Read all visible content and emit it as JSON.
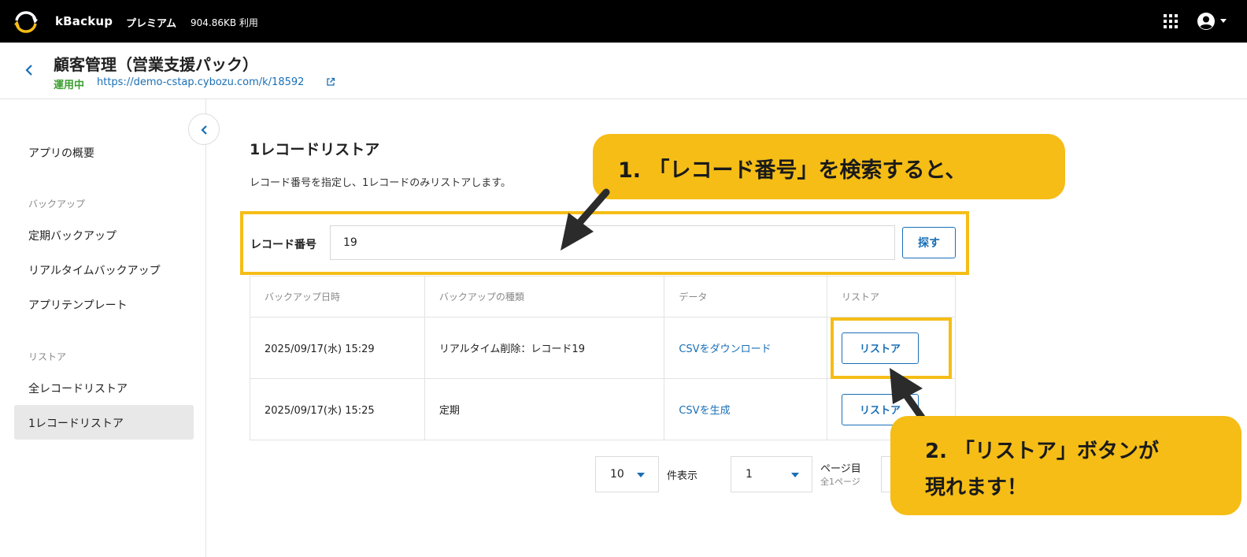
{
  "topbar": {
    "brand": "kBackup",
    "plan": "プレミアム",
    "usage": "904.86KB 利用",
    "icons": [
      "kbackup-logo-icon",
      "apps-grid-icon",
      "user-account-icon",
      "caret-down-icon"
    ]
  },
  "app": {
    "title": "顧客管理（営業支援パック）",
    "status": "運用中",
    "url": "https://demo-cstap.cybozu.com/k/18592"
  },
  "sidebar": {
    "overview": "アプリの概要",
    "backup_section": "バックアップ",
    "backup_items": [
      "定期バックアップ",
      "リアルタイムバックアップ",
      "アプリテンプレート"
    ],
    "restore_section": "リストア",
    "restore_items": [
      "全レコードリストア",
      "1レコードリストア"
    ],
    "active_item": "1レコードリストア"
  },
  "main": {
    "title": "1レコードリストア",
    "description": "レコード番号を指定し、1レコードのみリストアします。",
    "search": {
      "label": "レコード番号",
      "value": "19",
      "button": "探す"
    },
    "table": {
      "headers": [
        "バックアップ日時",
        "バックアップの種類",
        "データ",
        "リストア"
      ],
      "rows": [
        {
          "datetime": "2025/09/17(水) 15:29",
          "type": "リアルタイム削除：レコード19",
          "data": "CSVをダウンロード",
          "action": "リストア"
        },
        {
          "datetime": "2025/09/17(水) 15:25",
          "type": "定期",
          "data": "CSVを生成",
          "action": "リストア"
        }
      ]
    },
    "pager": {
      "per_page": "10",
      "per_page_label": "件表示",
      "page": "1",
      "page_label": "ページ目",
      "total_label": "全1ページ"
    }
  },
  "annotations": {
    "callout1": "1. 「レコード番号」を検索すると、",
    "callout2_line1": "2. 「リストア」ボタンが",
    "callout2_line2": "現れます！",
    "highlight_color": "#f5bd16"
  },
  "colors": {
    "accent": "#1a6fb5",
    "status_green": "#3c9e2f",
    "topbar": "#000000"
  }
}
